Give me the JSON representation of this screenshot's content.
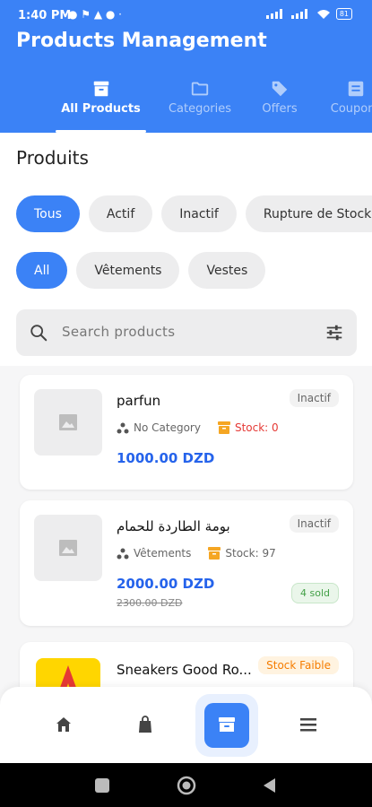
{
  "status_bar": {
    "time": "1:40 PM",
    "notifications": "● ⚑ ▲ ●  ·",
    "battery": "81"
  },
  "app": {
    "title": "Products Management"
  },
  "tabs": [
    {
      "label": "All Products",
      "icon": "archive-icon",
      "active": true
    },
    {
      "label": "Categories",
      "icon": "folder-icon",
      "active": false
    },
    {
      "label": "Offers",
      "icon": "tag-icon",
      "active": false
    },
    {
      "label": "Coupons",
      "icon": "ticket-icon",
      "active": false
    }
  ],
  "section_title": "Produits",
  "status_filters": [
    {
      "label": "Tous",
      "active": true
    },
    {
      "label": "Actif",
      "active": false
    },
    {
      "label": "Inactif",
      "active": false
    },
    {
      "label": "Rupture de Stock",
      "active": false
    }
  ],
  "category_filters": [
    {
      "label": "All",
      "active": true
    },
    {
      "label": "Vêtements",
      "active": false
    },
    {
      "label": "Vestes",
      "active": false
    }
  ],
  "search": {
    "placeholder": "Search products"
  },
  "products": [
    {
      "name": "parfun",
      "status": "Inactif",
      "category": "No Category",
      "stock": "Stock: 0",
      "price": "1000.00 DZD"
    },
    {
      "name": "بومة الطاردة للحمام",
      "status": "Inactif",
      "category": "Vêtements",
      "stock": "Stock: 97",
      "price": "2000.00 DZD",
      "old_price": "2300.00 DZD",
      "sold": "4 sold"
    },
    {
      "name": "Sneakers Good Ro...",
      "status": "Stock Faible"
    }
  ],
  "bottom_nav": [
    {
      "icon": "home-icon",
      "active": false
    },
    {
      "icon": "shopping-bag-icon",
      "active": false
    },
    {
      "icon": "archive-icon",
      "active": true
    },
    {
      "icon": "menu-icon",
      "active": false
    }
  ],
  "colors": {
    "primary": "#3b82f6",
    "price": "#2563eb",
    "stock_zero": "#e53935",
    "low_stock_bg": "#fff3e0",
    "sold": "#43a047"
  }
}
